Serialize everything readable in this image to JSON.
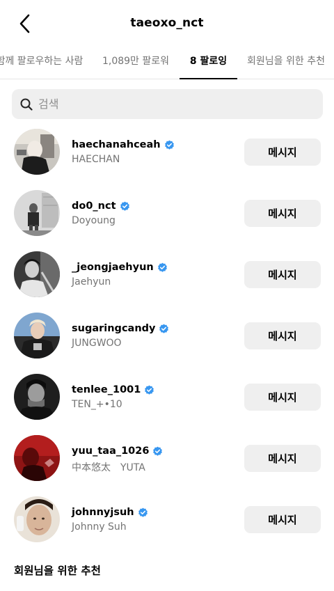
{
  "header": {
    "title": "taeoxo_nct",
    "back_icon": "chevron-left-icon"
  },
  "tabs": [
    {
      "label": "함께 팔로우하는 사람",
      "active": false
    },
    {
      "label": "1,089만 팔로워",
      "active": false
    },
    {
      "label": "8 팔로잉",
      "active": true
    },
    {
      "label": "회원님을 위한 추천",
      "active": false
    }
  ],
  "search": {
    "placeholder": "검색",
    "icon": "search-icon"
  },
  "following": [
    {
      "username": "haechanahceah",
      "full_name": "HAECHAN",
      "verified": true,
      "button": "메시지"
    },
    {
      "username": "do0_nct",
      "full_name": "Doyoung",
      "verified": true,
      "button": "메시지"
    },
    {
      "username": "_jeongjaehyun",
      "full_name": "Jaehyun",
      "verified": true,
      "button": "메시지"
    },
    {
      "username": "sugaringcandy",
      "full_name": "JUNGWOO",
      "verified": true,
      "button": "메시지"
    },
    {
      "username": "tenlee_1001",
      "full_name": "TEN_+•10",
      "verified": true,
      "button": "메시지"
    },
    {
      "username": "yuu_taa_1026",
      "full_name": "中本悠太　YUTA",
      "verified": true,
      "button": "메시지"
    },
    {
      "username": "johnnyjsuh",
      "full_name": "Johnny Suh",
      "verified": true,
      "button": "메시지"
    }
  ],
  "suggestions": {
    "title": "회원님을 위한 추천"
  },
  "colors": {
    "verified_blue": "#3897f0",
    "button_bg": "#efefef",
    "secondary_text": "#737373"
  }
}
